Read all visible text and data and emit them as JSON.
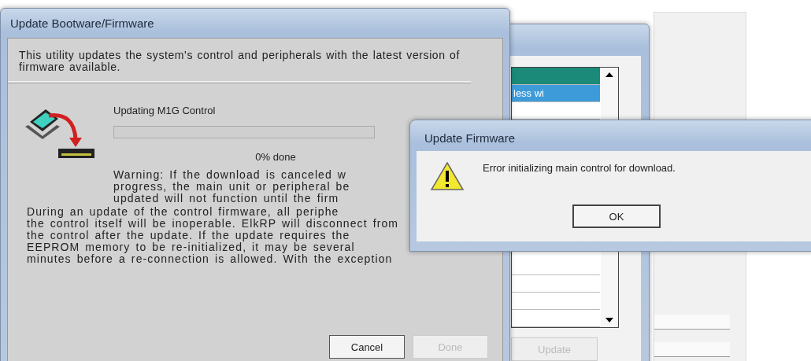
{
  "main_dialog": {
    "title": "Update Bootware/Firmware",
    "intro": "This utility updates the system's control and peripherals with the latest version of firmware available.",
    "status": "Updating M1G Control",
    "progress": {
      "level": 0
    },
    "progress_label": "0% done",
    "warning_lines": [
      "Warning: If the download is canceled w",
      "progress, the main unit or peripheral be",
      "updated will not function until the firm"
    ],
    "info_lines": [
      "During an update of the control firmware, all periphe",
      "the control itself will be inoperable.  ElkRP will disconnect from",
      "the control after the update.  If the update requires the",
      "EEPROM memory to be re-initialized, it may be several",
      "minutes before a re-connection is allowed.  With the exception"
    ],
    "buttons": [
      {
        "label": "Cancel",
        "disabled": false
      },
      {
        "label": "Done",
        "disabled": true
      }
    ]
  },
  "back_window": {
    "list_items": [
      {
        "selected": true,
        "color": "#1b8a78"
      },
      {
        "label": "less wi",
        "selected": true,
        "color": "#3d9bd9"
      },
      {
        "selected": false
      },
      {
        "selected": false
      },
      {
        "selected": false
      },
      {
        "selected": false
      },
      {
        "selected": false
      }
    ],
    "button": {
      "label": "Update",
      "disabled": true
    }
  },
  "error_dialog": {
    "title": "Update Firmware",
    "message": "Error initializing main control for download.",
    "buttons": [
      {
        "label": "OK",
        "disabled": false
      }
    ]
  }
}
